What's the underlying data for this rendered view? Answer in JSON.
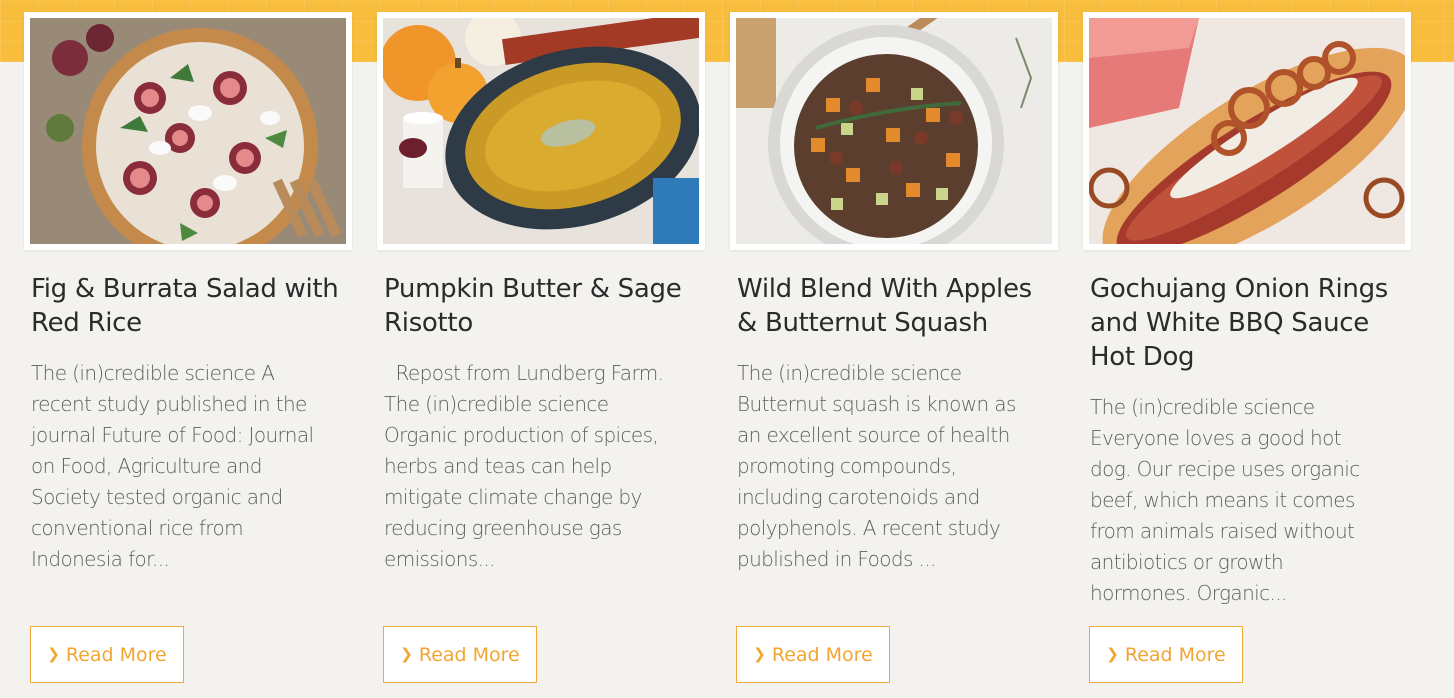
{
  "colors": {
    "band": "#f8bd3c",
    "background": "#f3f2ef",
    "accent": "#f2a531",
    "title": "#2b2b2b",
    "text": "#5e5e5e"
  },
  "cards": [
    {
      "image_alt": "Fig and burrata salad in a wooden bowl",
      "title": "Fig & Burrata Salad with Red Rice",
      "excerpt": "The (in)credible science  A recent study published in the journal Future of Food: Journal on Food, Agriculture and Society tested organic and conventional rice from Indonesia for...",
      "cta_icon": "chevron-right-icon",
      "cta": "Read More"
    },
    {
      "image_alt": "Pumpkin butter and sage risotto in a dark bowl",
      "title": "Pumpkin Butter & Sage Risotto",
      "excerpt": "  Repost from Lundberg Farm.    The (in)credible science  Organic production of spices, herbs and teas can help mitigate climate change by reducing greenhouse gas emissions...",
      "cta_icon": "chevron-right-icon",
      "cta": "Read More"
    },
    {
      "image_alt": "Wild rice blend with apples and butternut squash",
      "title": "Wild Blend With Apples & Butternut Squash",
      "excerpt": "The (in)credible science Butternut squash is known as an excellent source of health promoting compounds, including carotenoids and polyphenols. A recent study published in Foods ...",
      "cta_icon": "chevron-right-icon",
      "cta": "Read More"
    },
    {
      "image_alt": "Hot dog topped with gochujang onion rings and white BBQ sauce",
      "title": "Gochujang Onion Rings and White BBQ Sauce Hot Dog",
      "excerpt": "The (in)credible science Everyone loves a good hot dog. Our recipe uses organic beef, which means it comes from animals raised without antibiotics or growth hormones. Organic...",
      "cta_icon": "chevron-right-icon",
      "cta": "Read More"
    }
  ]
}
